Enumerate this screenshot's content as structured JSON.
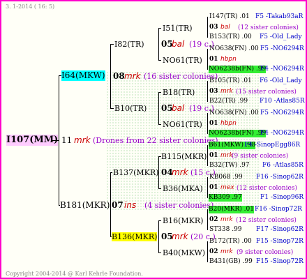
{
  "header": {
    "date": "3.  1-2014 ( 16:  5)"
  },
  "footer": {
    "copyright": "Copyright 2004-2014 @ Karl Kehrle Foundation."
  },
  "root": {
    "id": "I107(MM)",
    "year": "11",
    "gen_mark": "mrk",
    "note": "(Drones from 22 sister colonies)"
  },
  "g1": [
    {
      "id": "I64(MKW)",
      "year": "08",
      "gen_mark": "mrk",
      "note": "(16 sister colonies)"
    },
    {
      "id": "B181(MKR)",
      "year": "07",
      "gen_mark": "ins",
      "note": "(4 sister colonies)"
    }
  ],
  "g2": [
    {
      "id": "I82(TR)",
      "year": "05",
      "gen_mark": "bal",
      "note": "(19 c.)"
    },
    {
      "id": "B10(TR)",
      "year": "05",
      "gen_mark": "bal",
      "note": "(19 c.)"
    },
    {
      "id": "B137(MKR)",
      "year": "04",
      "gen_mark": "mrk",
      "note": "(15 c.)"
    },
    {
      "id": "B136(MKR)",
      "year": "05",
      "gen_mark": "mrk",
      "note": "(20 c.)"
    }
  ],
  "g3": [
    {
      "id": "I51(TR)"
    },
    {
      "id": "NO61(TR)"
    },
    {
      "id": "B18(TR)"
    },
    {
      "id": "NO61(TR)"
    },
    {
      "id": "B115(MKR)"
    },
    {
      "id": "B36(MKA)"
    },
    {
      "id": "B16(MKR)"
    },
    {
      "id": "B40(MKW)"
    }
  ],
  "g4": [
    {
      "sire": "I147(TR) .01",
      "sire_code": "F5 -Takab93aR",
      "year": "03",
      "gen_mark": "bal",
      "note": "(12 sister colonies)",
      "dam": "B153(TR) .00",
      "dam_code": "F5 -Old_Lady"
    },
    {
      "sire": "NO638(FN) .00",
      "sire_code": "F5 -NO6294R",
      "year": "01",
      "gen_mark": "hbpn",
      "note": "",
      "dam": "NO6238b(FN) .99",
      "dam_code": "F4 -NO6294R"
    },
    {
      "sire": "B105(TR) .01",
      "sire_code": "F6 -Old_Lady",
      "year": "03",
      "gen_mark": "mrk",
      "note": "(15 sister colonies)",
      "dam": "B22(TR) .99",
      "dam_code": "F10 -Atlas85R"
    },
    {
      "sire": "NO638(FN) .00",
      "sire_code": "F5 -NO6294R",
      "year": "01",
      "gen_mark": "hbpn",
      "note": "",
      "dam": "NO6238b(FN) .99",
      "dam_code": "F4 -NO6294R"
    },
    {
      "sire": "B61(MKW) .98",
      "sire_code": "F4 -SinopEgg86R",
      "year": "01",
      "gen_mark": "mrk",
      "note": "(9 sister colonies)",
      "dam": "B32(TW) .97",
      "dam_code": "F6 -Atlas85R"
    },
    {
      "sire": "KB068 .99",
      "sire_code": "F16 -Sinop62R",
      "year": "01",
      "gen_mark": "mex",
      "note": "(12 sister colonies)",
      "dam": "KB309 .97",
      "dam_code": "F1 -Sinop96R"
    },
    {
      "sire": "B20(MKR) .01",
      "sire_code": "F16 -Sinop72R",
      "year": "02",
      "gen_mark": "mrk",
      "note": "(12 sister colonies)",
      "dam": "ST338 .99",
      "dam_code": "F17 -Sinop62R"
    },
    {
      "sire": "B172(TR) .00",
      "sire_code": "F15 -Sinop72R",
      "year": "02",
      "gen_mark": "mrk",
      "note": "(9 sister colonies)",
      "dam": "B431(GB) .99",
      "dam_code": "F15 -Sinop72R"
    }
  ]
}
